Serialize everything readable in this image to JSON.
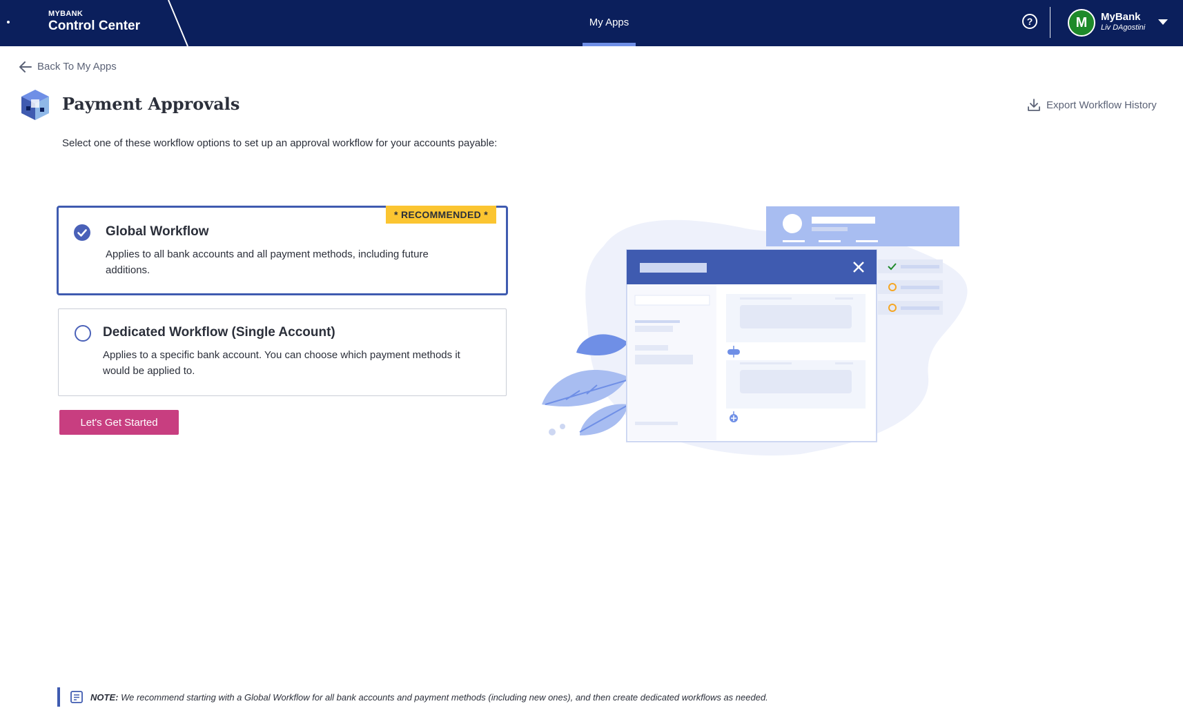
{
  "header": {
    "brand_small": "MYBANK",
    "brand_title": "Control Center",
    "nav_tab": "My Apps",
    "user_initial": "M",
    "user_org": "MyBank",
    "user_name": "Liv DAgostini"
  },
  "back_link": "Back To My Apps",
  "page": {
    "title": "Payment Approvals",
    "export_label": "Export Workflow History",
    "intro": "Select one of these workflow options to set up an approval workflow for your accounts payable:"
  },
  "options": [
    {
      "title": "Global Workflow",
      "description": "Applies to all bank accounts and all payment methods, including future additions.",
      "badge": "* RECOMMENDED *",
      "selected": true
    },
    {
      "title": "Dedicated Workflow (Single Account)",
      "description": "Applies to a specific bank account. You can choose which payment methods it would be applied to.",
      "selected": false
    }
  ],
  "cta_label": "Let's Get Started",
  "note": {
    "label": "NOTE:",
    "text": "We recommend starting with a Global Workflow for all bank accounts and payment methods (including new ones), and then create dedicated workflows as needed."
  },
  "colors": {
    "topbar": "#0b1f5c",
    "accent": "#3f5bb0",
    "cta": "#c83e80",
    "badge": "#fbc531",
    "avatar": "#1e8a2a"
  }
}
